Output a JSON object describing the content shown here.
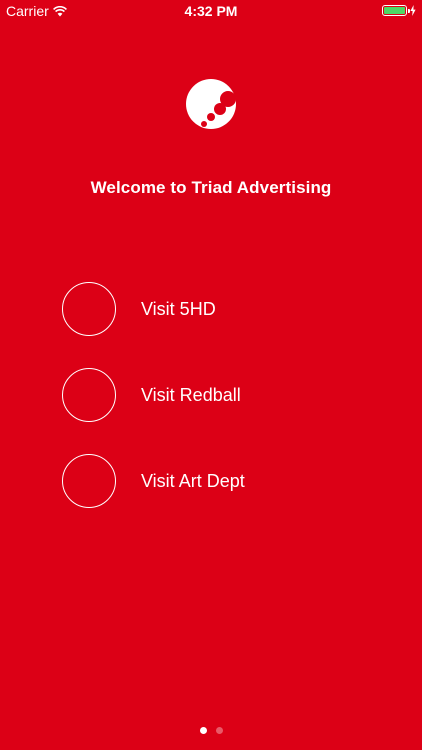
{
  "status_bar": {
    "carrier": "Carrier",
    "time": "4:32 PM",
    "battery_level": 1.0,
    "battery_color": "#4cd964",
    "icons": [
      "wifi-icon",
      "battery-icon",
      "charging-icon"
    ]
  },
  "colors": {
    "background": "#dc0016",
    "foreground": "#ffffff"
  },
  "logo": {
    "icon": "triad-logo-icon"
  },
  "welcome": {
    "title": "Welcome to Triad Advertising"
  },
  "menu": {
    "items": [
      {
        "label": "Visit 5HD"
      },
      {
        "label": "Visit Redball"
      },
      {
        "label": "Visit Art Dept"
      }
    ]
  },
  "pager": {
    "page_count": 2,
    "current_page": 1
  }
}
